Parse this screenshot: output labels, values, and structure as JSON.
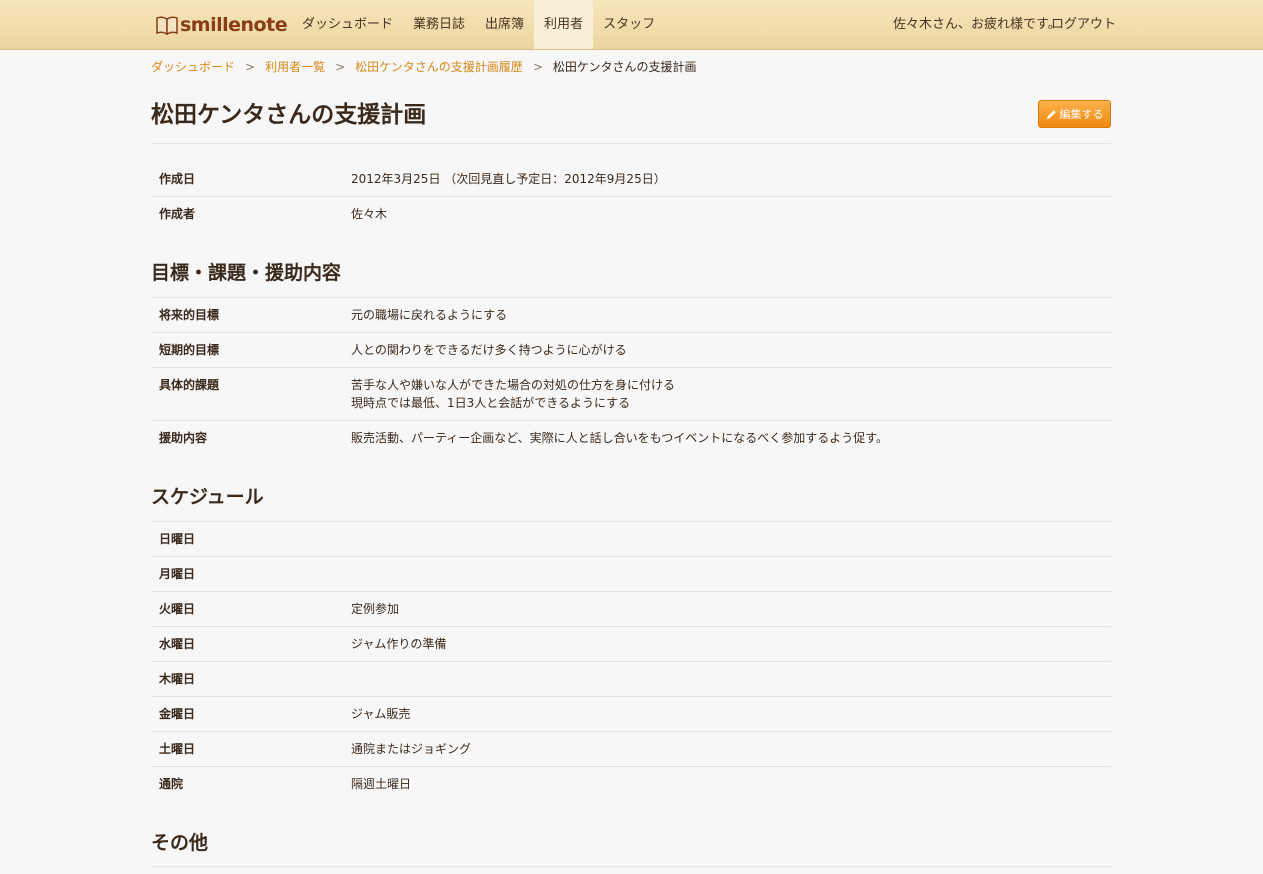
{
  "header": {
    "logo_text": "smillenote",
    "nav": [
      "ダッシュボード",
      "業務日誌",
      "出席簿",
      "利用者",
      "スタッフ"
    ],
    "active_nav": "利用者",
    "greeting": "佐々木さん、お疲れ様です。",
    "logout": "ログアウト"
  },
  "breadcrumb": {
    "links": [
      "ダッシュボード",
      "利用者一覧",
      "松田ケンタさんの支援計画履歴"
    ],
    "separator": ">",
    "current": "松田ケンタさんの支援計画"
  },
  "page": {
    "title": "松田ケンタさんの支援計画",
    "edit_button": "編集する"
  },
  "meta": [
    {
      "label": "作成日",
      "value": "2012年3月25日 （次回見直し予定日：2012年9月25日）"
    },
    {
      "label": "作成者",
      "value": "佐々木"
    }
  ],
  "goals": {
    "title": "目標・課題・援助内容",
    "rows": [
      {
        "label": "将来的目標",
        "lines": [
          "元の職場に戻れるようにする"
        ]
      },
      {
        "label": "短期的目標",
        "lines": [
          "人との関わりをできるだけ多く持つように心がける"
        ]
      },
      {
        "label": "具体的課題",
        "lines": [
          "苦手な人や嫌いな人ができた場合の対処の仕方を身に付ける",
          "現時点では最低、1日3人と会話ができるようにする"
        ]
      },
      {
        "label": "援助内容",
        "lines": [
          "販売活動、パーティー企画など、実際に人と話し合いをもつイベントになるべく参加するよう促す。"
        ]
      }
    ]
  },
  "schedule": {
    "title": "スケジュール",
    "rows": [
      {
        "label": "日曜日",
        "value": ""
      },
      {
        "label": "月曜日",
        "value": ""
      },
      {
        "label": "火曜日",
        "value": "定例参加"
      },
      {
        "label": "水曜日",
        "value": "ジャム作りの準備"
      },
      {
        "label": "木曜日",
        "value": ""
      },
      {
        "label": "金曜日",
        "value": "ジャム販売"
      },
      {
        "label": "土曜日",
        "value": "通院またはジョギング"
      },
      {
        "label": "通院",
        "value": "隔週土曜日"
      }
    ]
  },
  "other": {
    "title": "その他"
  },
  "colors": {
    "header_bg": "#ecd59f",
    "link": "#d68a1a",
    "button": "#f08a12",
    "text": "#3b2a1c"
  }
}
